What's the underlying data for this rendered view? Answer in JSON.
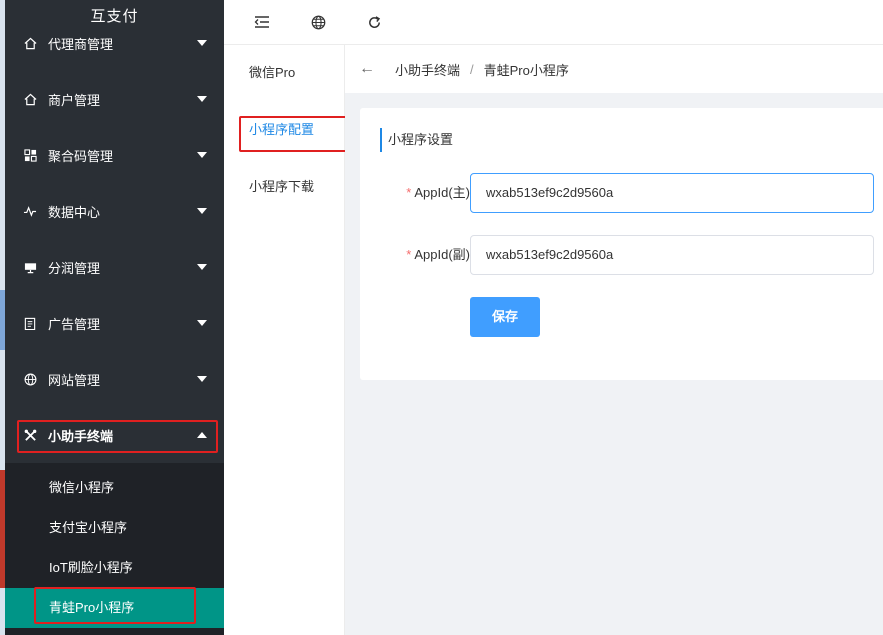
{
  "sidebar": {
    "brand": "互支付",
    "items": [
      {
        "label": "代理商管理",
        "icon": "home-icon"
      },
      {
        "label": "商户管理",
        "icon": "home-icon"
      },
      {
        "label": "聚合码管理",
        "icon": "grid-icon"
      },
      {
        "label": "数据中心",
        "icon": "pulse-icon"
      },
      {
        "label": "分润管理",
        "icon": "monitor-icon"
      },
      {
        "label": "广告管理",
        "icon": "clipboard-icon"
      },
      {
        "label": "网站管理",
        "icon": "globe-icon"
      },
      {
        "label": "小助手终端",
        "icon": "tools-icon"
      }
    ],
    "submenu": [
      {
        "label": "微信小程序"
      },
      {
        "label": "支付宝小程序"
      },
      {
        "label": "IoT刷脸小程序"
      },
      {
        "label": "青蛙Pro小程序"
      }
    ]
  },
  "topbar": {
    "buttons": [
      "fold-icon",
      "globe-icon",
      "refresh-icon"
    ]
  },
  "tabs": [
    {
      "label": "微信Pro"
    },
    {
      "label": "小程序配置"
    },
    {
      "label": "小程序下载"
    }
  ],
  "breadcrumb": {
    "back": "←",
    "parent": "小助手终端",
    "separator": "/",
    "current": "青蛙Pro小程序"
  },
  "form": {
    "title": "小程序设置",
    "required_mark": "*",
    "fields": [
      {
        "label": "AppId(主)",
        "value": "wxab513ef9c2d9560a"
      },
      {
        "label": "AppId(副)",
        "value": "wxab513ef9c2d9560a"
      }
    ],
    "save_label": "保存"
  },
  "colors": {
    "sidebar_bg": "#2a2f35",
    "active_sub": "#009587",
    "primary": "#409eff",
    "highlight": "#e02020"
  }
}
